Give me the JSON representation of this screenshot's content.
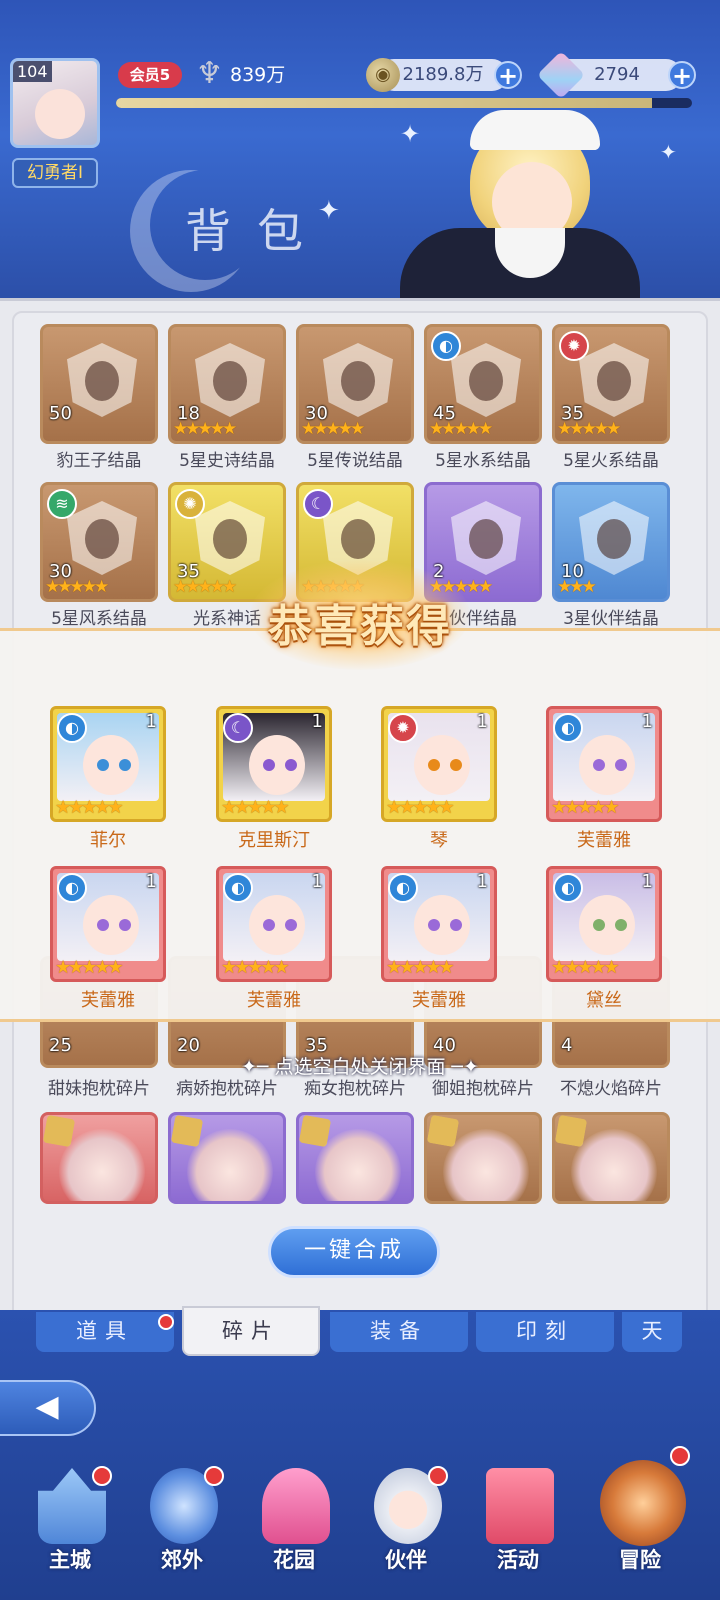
{
  "header": {
    "level": "104",
    "player_name": "幻勇者I",
    "vip": "会员5",
    "power": "839万",
    "gold": "2189.8万",
    "gems": "2794",
    "xp_fraction": 0.93,
    "title": "背包"
  },
  "bag_items": [
    {
      "count": "50",
      "label": "豹王子结晶",
      "stars": "",
      "color": "brown"
    },
    {
      "count": "18",
      "label": "5星史诗结晶",
      "stars": "★★★★★",
      "color": "brown"
    },
    {
      "count": "30",
      "label": "5星传说结晶",
      "stars": "★★★★★",
      "color": "brown"
    },
    {
      "count": "45",
      "label": "5星水系结晶",
      "stars": "★★★★★",
      "color": "brown",
      "element": "water"
    },
    {
      "count": "35",
      "label": "5星火系结晶",
      "stars": "★★★★★",
      "color": "brown",
      "element": "fire"
    },
    {
      "count": "30",
      "label": "5星风系结晶",
      "stars": "★★★★★",
      "color": "brown",
      "element": "wind"
    },
    {
      "count": "35",
      "label": "光系神话",
      "stars": "★★★★★",
      "color": "yellow",
      "element": "light"
    },
    {
      "count": "",
      "label": "",
      "stars": "★★★★★",
      "color": "yellow",
      "element": "dark"
    },
    {
      "count": "2",
      "label": "伙伴结晶",
      "stars": "★★★★★",
      "color": "purple"
    },
    {
      "count": "10",
      "label": "3星伙伴结晶",
      "stars": "★★★",
      "color": "blue"
    }
  ],
  "fragments": [
    {
      "count": "25",
      "label": "甜妹抱枕碎片"
    },
    {
      "count": "20",
      "label": "病娇抱枕碎片"
    },
    {
      "count": "35",
      "label": "痴女抱枕碎片"
    },
    {
      "count": "40",
      "label": "御姐抱枕碎片"
    },
    {
      "count": "4",
      "label": "不熄火焰碎片"
    }
  ],
  "craft_button": "一键合成",
  "tabs": [
    "道具",
    "碎片",
    "装备",
    "印刻",
    "天"
  ],
  "nav": [
    "主城",
    "郊外",
    "花园",
    "伙伴",
    "活动",
    "冒险"
  ],
  "reward_popup": {
    "title": "恭喜获得",
    "close_hint": "点选空白处关闭界面",
    "rewards": [
      {
        "name": "菲尔",
        "qty": "1",
        "stars": "★★★★★",
        "element": "water",
        "frame": "gold"
      },
      {
        "name": "克里斯汀",
        "qty": "1",
        "stars": "★★★★★",
        "element": "dark",
        "frame": "gold"
      },
      {
        "name": "琴",
        "qty": "1",
        "stars": "★★★★★",
        "element": "fire",
        "frame": "gold"
      },
      {
        "name": "芙蕾雅",
        "qty": "1",
        "stars": "★★★★★",
        "element": "water",
        "frame": "rose"
      },
      {
        "name": "芙蕾雅",
        "qty": "1",
        "stars": "★★★★★",
        "element": "water",
        "frame": "rose"
      },
      {
        "name": "芙蕾雅",
        "qty": "1",
        "stars": "★★★★★",
        "element": "water",
        "frame": "rose"
      },
      {
        "name": "芙蕾雅",
        "qty": "1",
        "stars": "★★★★★",
        "element": "water",
        "frame": "rose"
      },
      {
        "name": "黛丝",
        "qty": "1",
        "stars": "★★★★★",
        "element": "water",
        "frame": "rose"
      }
    ]
  },
  "colors": {
    "accent": "#2f6fd6",
    "star": "#ffb21a",
    "reward_name": "#c9691a",
    "badge": "#e53a3a"
  },
  "icons": {
    "power": "sword-icon",
    "gold": "coin-icon",
    "gems": "crystal-icon",
    "back": "back-arrow-icon"
  }
}
